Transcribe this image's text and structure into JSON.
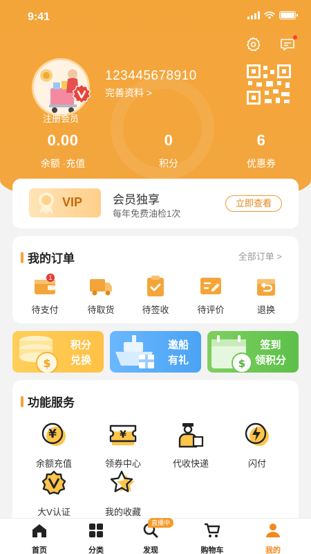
{
  "status_bar": {
    "time": "9:41"
  },
  "header": {
    "settings_icon": "gear-icon",
    "message_icon": "message-icon",
    "member_label": "注册会员",
    "user_id": "123445678910",
    "complete_profile": "完善资料 >",
    "qr_icon": "qr-code-icon"
  },
  "stats": [
    {
      "value": "0.00",
      "label": "余额 ·充值"
    },
    {
      "value": "0",
      "label": "积分"
    },
    {
      "value": "6",
      "label": "优惠券"
    }
  ],
  "vip": {
    "badge": "VIP",
    "title": "会员独享",
    "subtitle": "每年免费油检1次",
    "button": "立即查看"
  },
  "orders": {
    "title": "我的订单",
    "all_label": "全部订单 >",
    "items": [
      {
        "label": "待支付",
        "badge": "1"
      },
      {
        "label": "待取货"
      },
      {
        "label": "待签收"
      },
      {
        "label": "待评价"
      },
      {
        "label": "退换"
      }
    ]
  },
  "promos": [
    {
      "line1": "积分",
      "line2": "兑换"
    },
    {
      "line1": "邀船",
      "line2": "有礼"
    },
    {
      "line1": "签到",
      "line2": "领积分"
    }
  ],
  "services": {
    "title": "功能服务",
    "items": [
      {
        "label": "余额充值",
        "icon": "yen-coin-icon"
      },
      {
        "label": "领券中心",
        "icon": "coupon-ticket-icon"
      },
      {
        "label": "代收快递",
        "icon": "courier-icon"
      },
      {
        "label": "闪付",
        "icon": "lightning-pay-icon"
      },
      {
        "label": "大V认证",
        "icon": "v-badge-icon"
      },
      {
        "label": "我的收藏",
        "icon": "star-icon"
      }
    ]
  },
  "tabbar": {
    "hot_tag": "直播中",
    "items": [
      {
        "label": "首页",
        "icon": "home-icon"
      },
      {
        "label": "分类",
        "icon": "grid-icon"
      },
      {
        "label": "发现",
        "icon": "search-icon"
      },
      {
        "label": "购物车",
        "icon": "cart-icon"
      },
      {
        "label": "我的",
        "icon": "user-icon"
      }
    ]
  },
  "colors": {
    "accent": "#f4a53a",
    "active_tab": "#f08a1c"
  }
}
